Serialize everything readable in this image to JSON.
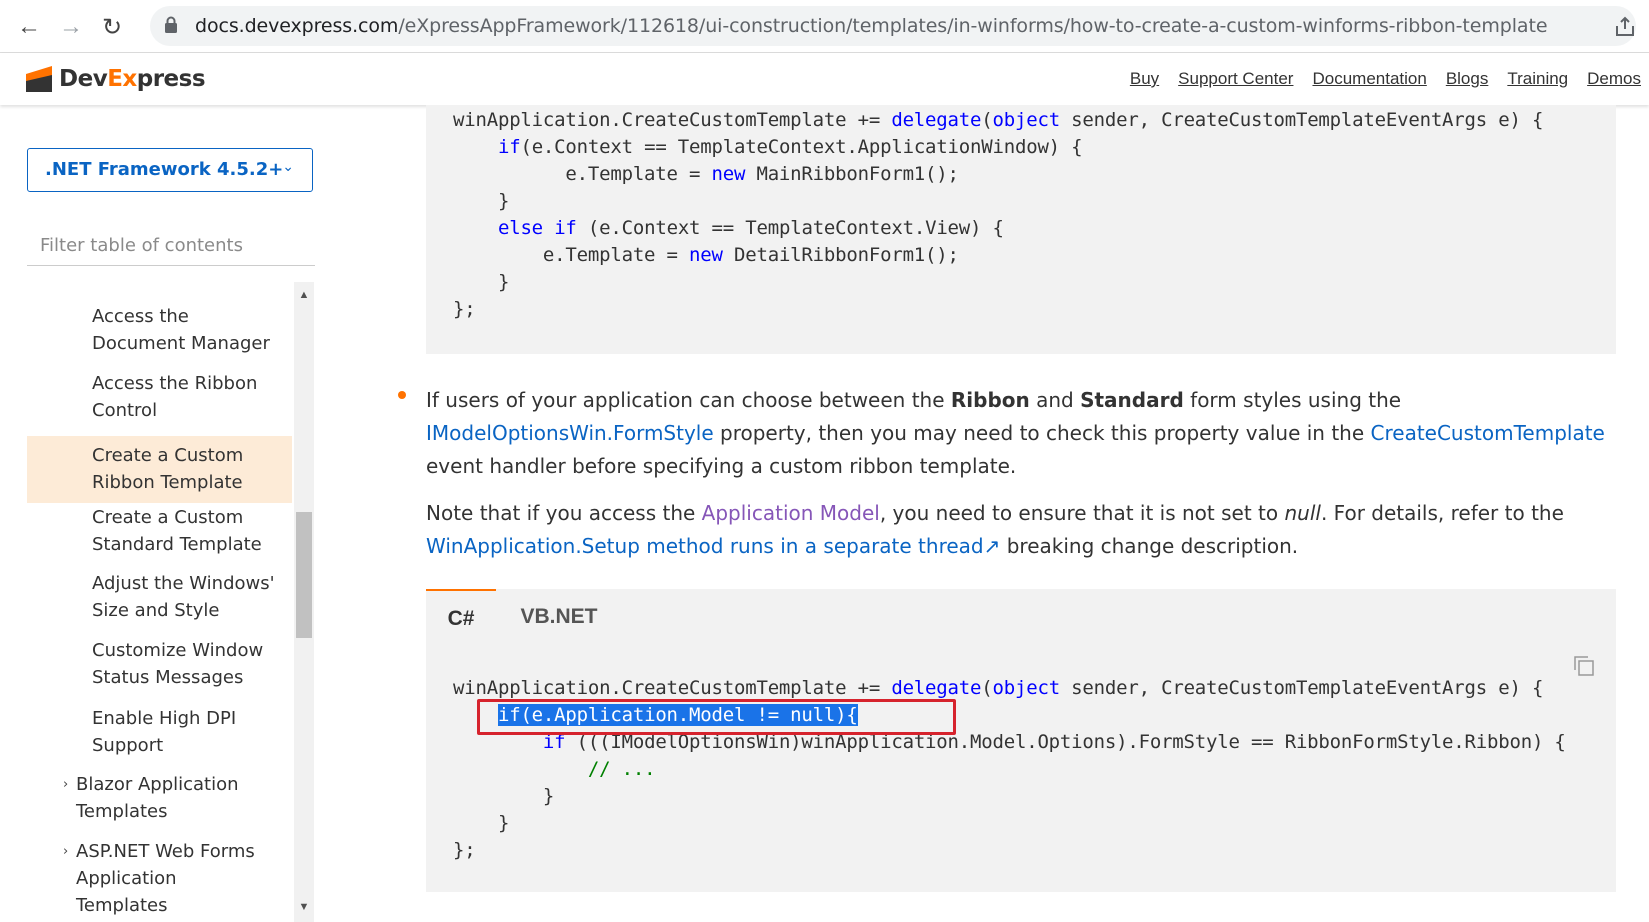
{
  "browser": {
    "url_host": "docs.devexpress.com",
    "url_path": "/eXpressAppFramework/112618/ui-construction/templates/in-winforms/how-to-create-a-custom-winforms-ribbon-template"
  },
  "header": {
    "brand_dev": "Dev",
    "brand_x": "Ex",
    "brand_press": "press",
    "nav": [
      "Buy",
      "Support Center",
      "Documentation",
      "Blogs",
      "Training",
      "Demos"
    ]
  },
  "sidebar": {
    "framework_select": ".NET Framework 4.5.2+",
    "filter_placeholder": "Filter table of contents",
    "items": [
      {
        "label": "Access the Document Manager"
      },
      {
        "label": "Access the Ribbon Control"
      },
      {
        "label": "Create a Custom Ribbon Template",
        "active": true
      },
      {
        "label": "Create a Custom Standard Template"
      },
      {
        "label": "Adjust the Windows' Size and Style"
      },
      {
        "label": "Customize Window Status Messages"
      },
      {
        "label": "Enable High DPI Support"
      },
      {
        "label": "Blazor Application Templates",
        "expandable": true
      },
      {
        "label": "ASP.NET Web Forms Application Templates",
        "expandable": true
      }
    ]
  },
  "content": {
    "para1": {
      "t1": "If users of your application can choose between the ",
      "b1": "Ribbon",
      "t2": " and ",
      "b2": "Standard",
      "t3": " form styles using the ",
      "link1": "IModelOptionsWin.FormStyle",
      "t4": " property, then you may need to check this property value in the ",
      "link2": "CreateCustomTemplate",
      "t5": " event handler before specifying a custom ribbon template."
    },
    "para2": {
      "t1": "Note that if you access the ",
      "link1": "Application Model",
      "t2": ", you need to ensure that it is not set to ",
      "i1": "null",
      "t3": ". For details, refer to the ",
      "link2": "WinApplication.Setup method runs in a separate thread",
      "t4": " breaking change description."
    },
    "tabs": [
      "C#",
      "VB.NET"
    ]
  },
  "colors": {
    "accent": "#ff7200",
    "link": "#0a64c3",
    "highlight_box": "#d6232d",
    "selection": "#1a73e8"
  }
}
